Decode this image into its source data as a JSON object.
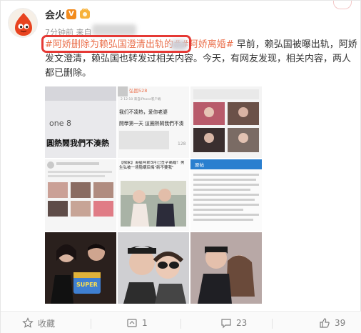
{
  "user": {
    "name": "会火",
    "verified_mark": "V",
    "meta_prefix": "7分钟前 来自"
  },
  "post": {
    "tag1": "#阿娇删除为赖弘国澄清出轨的",
    "tag1_end": "#",
    "tag2": "#阿娇离婚#",
    "body": " 早前，赖弘国被曝出轨，阿娇发文澄清，赖弘国也转发过相关内容。今天，有网友发现，相关内容，两人都已删除。"
  },
  "thumbnails": {
    "p1_caption_a": "one 8",
    "p1_caption_b": "圓熱鬧我們不湊熱",
    "p2_header": "弘国528",
    "p2_source": "2 12:10 来自iPhone客户端",
    "p2_line1": "我们不凑热，爱你老婆",
    "p2_line2": "開學第一天 這圈熱鬧我們不湊",
    "p2_stats": "128",
    "p5_title": "【独家】港星阿娇3月已签字离婚！男生弘被一场隐瞒后悔\"新不要我\"",
    "p6_header": "原帖",
    "p7_cake_text": "SUPER"
  },
  "actions": {
    "favorite": "收藏",
    "repost": "1",
    "comment": "23",
    "like": "39"
  },
  "colors": {
    "tag": "#eb7350",
    "highlight_box": "#e53935",
    "verified": "#f28b1e",
    "avatar_icon": "#e8431f"
  },
  "icons": [
    "fire-drop-icon",
    "verified-icon",
    "level-badge-icon",
    "star-icon",
    "repost-icon",
    "comment-icon",
    "thumbs-up-icon"
  ]
}
